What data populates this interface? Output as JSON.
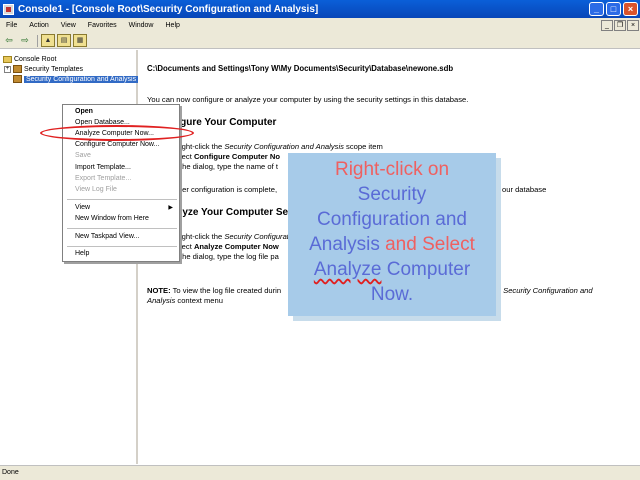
{
  "window": {
    "title": "Console1 - [Console Root\\Security Configuration and Analysis]"
  },
  "menubar": {
    "items": [
      "File",
      "Action",
      "View",
      "Favorites",
      "Window",
      "Help"
    ]
  },
  "tree": {
    "root": "Console Root",
    "items": [
      {
        "label": "Security Templates"
      },
      {
        "label": "Security Configuration and Analysis"
      }
    ]
  },
  "content": {
    "db_path": "C:\\Documents and Settings\\Tony W\\My Documents\\Security\\Database\\newone.sdb",
    "intro": "You can now configure or analyze your computer by using the security settings in this database.",
    "section1": {
      "heading": "figure Your Computer",
      "step1": [
        "ight-click the ",
        "Security Configuration and Analysis",
        " scope item"
      ],
      "step2": [
        "lect ",
        "Configure Computer No"
      ],
      "step3": "the dialog, type the name of t",
      "complete": "ter configuration is complete,",
      "complete_tail": "our database"
    },
    "section2": {
      "heading": "alyze Your Computer Se",
      "step1": [
        "ight-click the ",
        "Security Configurati"
      ],
      "step2": [
        "lect ",
        "Analyze Computer Now"
      ],
      "step3": "the dialog, type the log file pa"
    },
    "note": {
      "label": "NOTE:",
      "text": " To view the log file created durin",
      "tail": "se ",
      "tail_italic": "Security Configuration and",
      "line2_italic": "Analysis",
      "line2": " context menu"
    }
  },
  "context_menu": {
    "open": "Open",
    "open_database": "Open Database...",
    "analyze": "Analyze Computer Now...",
    "configure": "Configure Computer Now...",
    "save": "Save",
    "import_template": "Import Template...",
    "export_template": "Export Template...",
    "view_log": "View Log File",
    "view": "View",
    "new_window": "New Window from Here",
    "new_taskpad": "New Taskpad View...",
    "help": "Help"
  },
  "callout": {
    "l1": "Right-click on",
    "l2": "Security",
    "l3": "Configuration and",
    "l4a": "Analysis",
    "l4b": " and Select",
    "l5a": "Analyze",
    "l5b": " Computer",
    "l6": "Now."
  },
  "status": {
    "text": "Done"
  },
  "colors": {
    "title_bar": "#0a5fd8",
    "callout_bg": "#a7cbe9",
    "callout_red": "#ef6060",
    "callout_blue": "#5a6bd6",
    "highlight": "#e02020"
  }
}
